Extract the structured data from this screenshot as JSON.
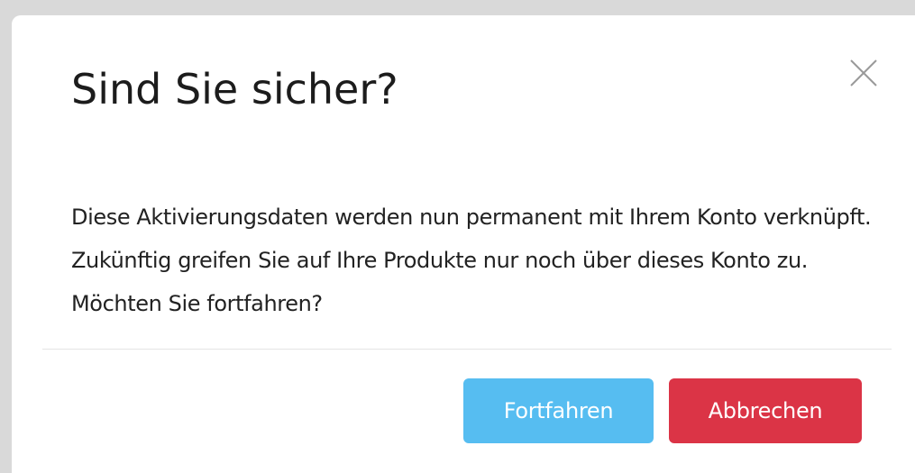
{
  "dialog": {
    "title": "Sind Sie sicher?",
    "close_icon": "close-icon",
    "body": "Diese Aktivierungsdaten werden nun permanent mit Ihrem Konto verknüpft. Zukünftig greifen Sie auf Ihre Produkte nur noch über dieses Konto zu. Möchten Sie fortfahren?",
    "buttons": {
      "continue_label": "Fortfahren",
      "cancel_label": "Abbrechen"
    }
  },
  "colors": {
    "continue": "#56bdf1",
    "cancel": "#db3446",
    "backdrop": "#d9d9d9"
  }
}
